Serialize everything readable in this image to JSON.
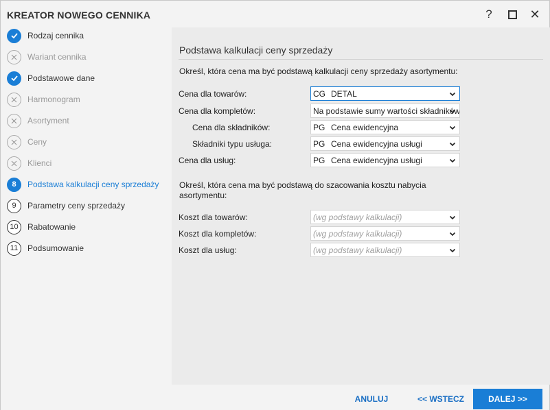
{
  "window": {
    "title": "KREATOR NOWEGO CENNIKA",
    "help": "?",
    "close": "✕"
  },
  "steps": [
    {
      "label": "Rodzaj cennika",
      "state": "done",
      "icon": "check-icon"
    },
    {
      "label": "Wariant cennika",
      "state": "skip",
      "icon": "x-icon"
    },
    {
      "label": "Podstawowe dane",
      "state": "done",
      "icon": "check-icon"
    },
    {
      "label": "Harmonogram",
      "state": "skip",
      "icon": "x-icon"
    },
    {
      "label": "Asortyment",
      "state": "skip",
      "icon": "x-icon"
    },
    {
      "label": "Ceny",
      "state": "skip",
      "icon": "x-icon"
    },
    {
      "label": "Klienci",
      "state": "skip",
      "icon": "x-icon"
    },
    {
      "label": "Podstawa kalkulacji ceny sprzedaży",
      "state": "active",
      "num": "8"
    },
    {
      "label": "Parametry ceny sprzedaży",
      "state": "todo",
      "num": "9"
    },
    {
      "label": "Rabatowanie",
      "state": "todo",
      "num": "10"
    },
    {
      "label": "Podsumowanie",
      "state": "todo",
      "num": "11"
    }
  ],
  "main": {
    "title": "Podstawa kalkulacji ceny sprzedaży",
    "desc1": "Określ, która cena ma być podstawą kalkulacji ceny sprzedaży asortymentu:",
    "desc2": "Określ, która cena ma być podstawą do szacowania kosztu nabycia asortymentu:",
    "fields": [
      {
        "label": "Cena dla towarów:",
        "code": "CG",
        "value": "DETAL"
      },
      {
        "label": "Cena dla kompletów:",
        "code": "",
        "value": "Na podstawie sumy wartości składników"
      },
      {
        "label": "Cena dla składników:",
        "code": "PG",
        "value": "Cena ewidencyjna"
      },
      {
        "label": "Składniki typu usługa:",
        "code": "PG",
        "value": "Cena ewidencyjna usługi"
      },
      {
        "label": "Cena dla usług:",
        "code": "PG",
        "value": "Cena ewidencyjna usługi"
      }
    ],
    "cost_fields": [
      {
        "label": "Koszt dla towarów:",
        "value": "(wg podstawy kalkulacji)"
      },
      {
        "label": "Koszt dla kompletów:",
        "value": "(wg podstawy kalkulacji)"
      },
      {
        "label": "Koszt dla usług:",
        "value": "(wg podstawy kalkulacji)"
      }
    ]
  },
  "footer": {
    "cancel": "ANULUJ",
    "back": "<< WSTECZ",
    "next": "DALEJ >>"
  },
  "colors": {
    "accent": "#1a7ed6"
  }
}
